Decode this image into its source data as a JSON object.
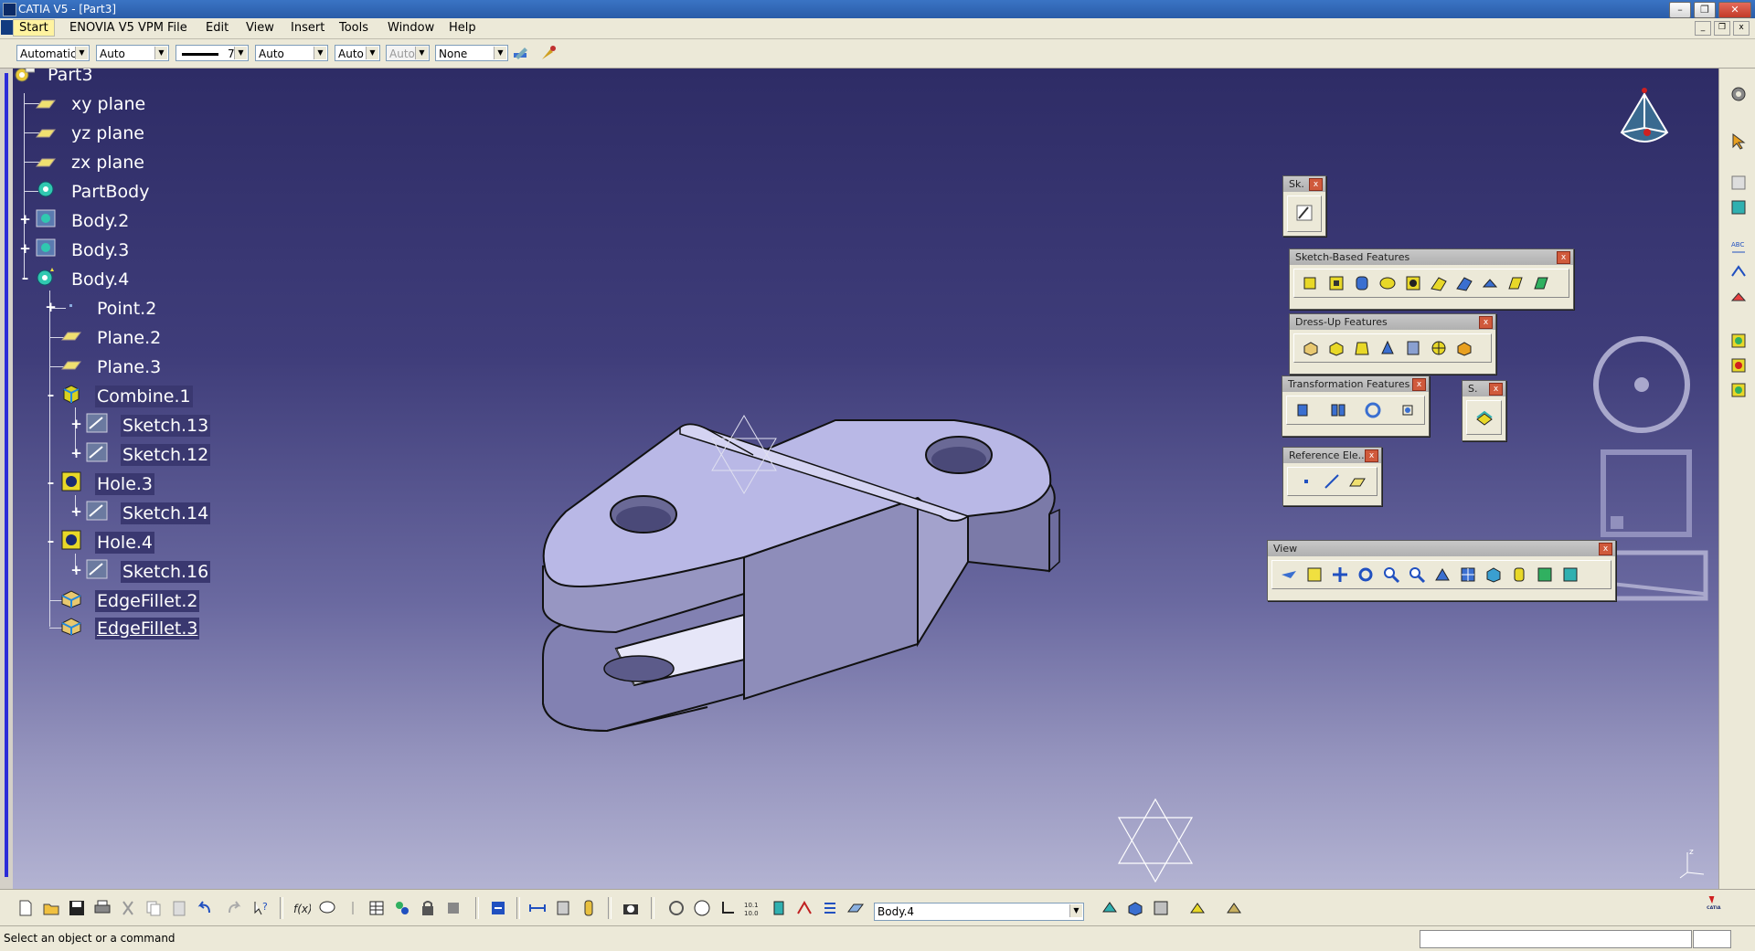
{
  "window": {
    "title": "CATIA V5 - [Part3]",
    "minimize": "–",
    "restore": "❐",
    "close": "✕"
  },
  "menu": {
    "start": "Start",
    "items": [
      "ENOVIA V5 VPM",
      "File",
      "Edit",
      "View",
      "Insert",
      "Tools",
      "Window",
      "Help"
    ]
  },
  "graphic_properties": {
    "color": "Automatic",
    "transparency": "Auto",
    "line_thickness": "7",
    "linetype": "Auto",
    "point_symbol": "Auto",
    "rendering": "Auto",
    "layer": "None"
  },
  "tree": [
    {
      "label": "Part3",
      "icon": "part-icon"
    },
    {
      "label": "xy plane",
      "icon": "plane-icon"
    },
    {
      "label": "yz plane",
      "icon": "plane-icon"
    },
    {
      "label": "zx plane",
      "icon": "plane-icon"
    },
    {
      "label": "PartBody",
      "icon": "body-icon"
    },
    {
      "label": "Body.2",
      "icon": "body-icon"
    },
    {
      "label": "Body.3",
      "icon": "body-icon"
    },
    {
      "label": "Body.4",
      "icon": "body-icon"
    },
    {
      "label": "Point.2",
      "icon": "point-icon"
    },
    {
      "label": "Plane.2",
      "icon": "plane-icon"
    },
    {
      "label": "Plane.3",
      "icon": "plane-icon"
    },
    {
      "label": "Combine.1",
      "icon": "combine-icon"
    },
    {
      "label": "Sketch.13",
      "icon": "sketch-icon"
    },
    {
      "label": "Sketch.12",
      "icon": "sketch-icon"
    },
    {
      "label": "Hole.3",
      "icon": "hole-icon"
    },
    {
      "label": "Sketch.14",
      "icon": "sketch-icon"
    },
    {
      "label": "Hole.4",
      "icon": "hole-icon"
    },
    {
      "label": "Sketch.16",
      "icon": "sketch-icon"
    },
    {
      "label": "EdgeFillet.2",
      "icon": "fillet-icon"
    },
    {
      "label": "EdgeFillet.3",
      "icon": "fillet-icon"
    }
  ],
  "toolbars": {
    "sketcher": "Sk.",
    "sketch_based": "Sketch-Based Features",
    "dress_up": "Dress-Up Features",
    "transformation": "Transformation Features",
    "surface": "S.",
    "reference": "Reference Ele...",
    "view": "View",
    "close_glyph": "x"
  },
  "bottom_toolbar": {
    "current_body": "Body.4"
  },
  "status": {
    "message": "Select an object or a command"
  },
  "compass_axis": "z",
  "colors": {
    "viewport_top": "#2e2c66",
    "viewport_bottom": "#b3b3d2",
    "part_face": "#b9b8e6",
    "tree_text": "#ffffff"
  }
}
